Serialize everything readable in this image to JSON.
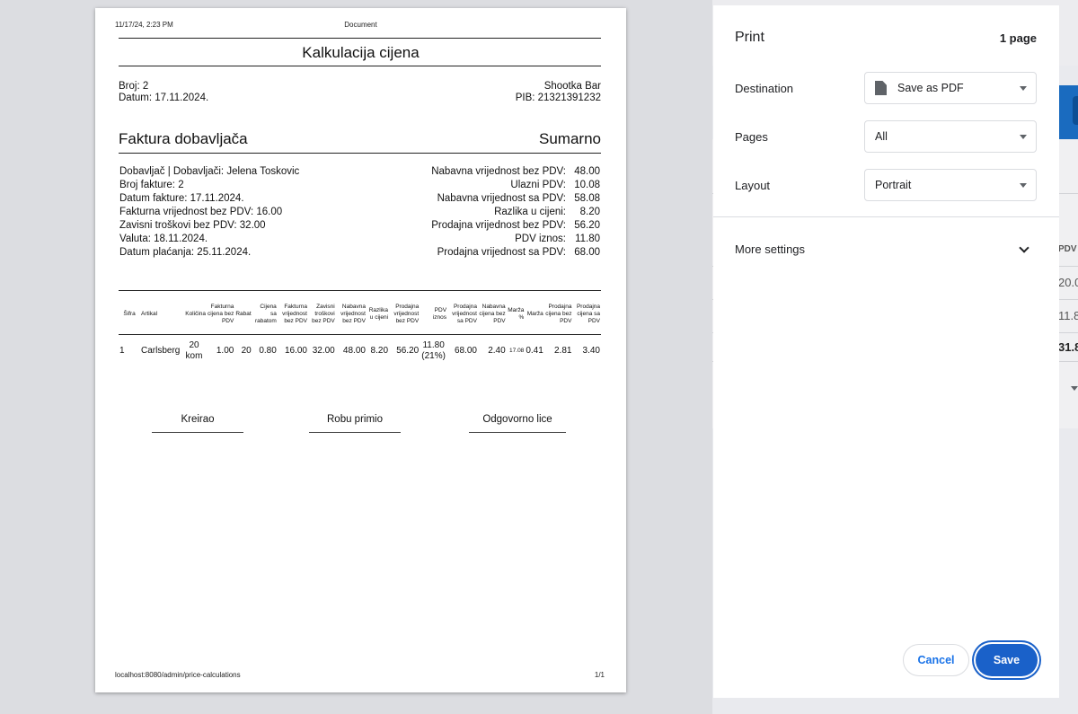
{
  "background": {
    "right_texts": [
      "PDV",
      "20.0",
      "11.8",
      "31.8"
    ]
  },
  "preview": {
    "header_datetime": "11/17/24, 2:23 PM",
    "header_center": "Document",
    "title": "Kalkulacija cijena",
    "broj": "Broj: 2",
    "datum": "Datum: 17.11.2024.",
    "company": "Shootka Bar",
    "pib": "PIB: 21321391232",
    "section_left": "Faktura dobavljača",
    "section_right": "Sumarno",
    "info": [
      "Dobavljač | Dobavljači: Jelena Toskovic",
      "Broj fakture: 2",
      "Datum fakture: 17.11.2024.",
      "Fakturna vrijednost bez PDV: 16.00",
      "Zavisni troškovi bez PDV: 32.00",
      "Valuta: 18.11.2024.",
      "Datum plaćanja: 25.11.2024."
    ],
    "summary": [
      {
        "label": "Nabavna vrijednost bez PDV:",
        "value": "48.00"
      },
      {
        "label": "Ulazni PDV:",
        "value": "10.08"
      },
      {
        "label": "Nabavna vrijednost sa PDV:",
        "value": "58.08"
      },
      {
        "label": "Razlika u cijeni:",
        "value": "8.20"
      },
      {
        "label": "Prodajna vrijednost bez PDV:",
        "value": "56.20"
      },
      {
        "label": "PDV iznos:",
        "value": "11.80"
      },
      {
        "label": "Prodajna vrijednost sa PDV:",
        "value": "68.00"
      }
    ],
    "table_headers": [
      "Šifra",
      "Artikal",
      "Količina",
      "Fakturna cijena bez PDV",
      "Rabat",
      "Cijena sa rabatom",
      "Fakturna vrijednost bez PDV",
      "Zavisni troškovi bez PDV",
      "Nabavna vrijednost bez PDV",
      "Razlika u cijeni",
      "Prodajna vrijednost bez PDV",
      "PDV iznos",
      "Prodajna vrijednost sa PDV",
      "Nabavna cijena bez PDV",
      "Marža %",
      "Marža",
      "Prodajna cijena bez PDV",
      "Prodajna cijena sa PDV"
    ],
    "table_row": [
      "1",
      "Carlsberg",
      "20 kom",
      "1.00",
      "20",
      "0.80",
      "16.00",
      "32.00",
      "48.00",
      "8.20",
      "56.20",
      "11.80 (21%)",
      "68.00",
      "2.40",
      "17.08",
      "0.41",
      "2.81",
      "3.40"
    ],
    "signatures": [
      "Kreirao",
      "Robu primio",
      "Odgovorno lice"
    ],
    "footer_url": "localhost:8080/admin/price-calculations",
    "footer_page": "1/1"
  },
  "panel": {
    "title": "Print",
    "pages_count": "1 page",
    "destination_label": "Destination",
    "destination_value": "Save as PDF",
    "pages_label": "Pages",
    "pages_value": "All",
    "layout_label": "Layout",
    "layout_value": "Portrait",
    "more_settings": "More settings",
    "cancel": "Cancel",
    "save": "Save"
  }
}
